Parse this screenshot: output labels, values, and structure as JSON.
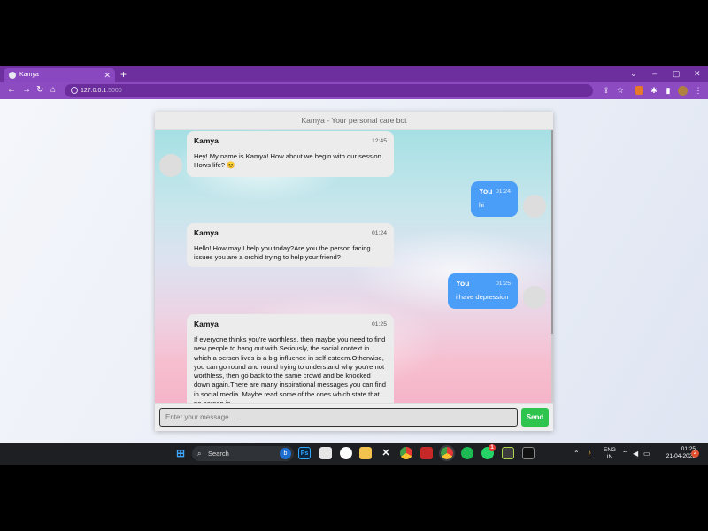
{
  "browser": {
    "tab_title": "Kamya",
    "tab_close": "✕",
    "new_tab": "+",
    "url_host": "127.0.0.1",
    "url_port": ":5000",
    "controls": {
      "collapse": "⌄",
      "minimize": "–",
      "maximize": "▢",
      "close": "✕"
    },
    "nav": {
      "back": "←",
      "forward": "→",
      "reload": "↻",
      "home": "⌂"
    }
  },
  "chat": {
    "header": "Kamya - Your personal care bot",
    "messages": [
      {
        "sender": "Kamya",
        "time": "12:45",
        "text": "Hey! My name is Kamya! How about we begin with our session. Hows life? 😊"
      },
      {
        "sender": "You",
        "time": "01:24",
        "text": "hi"
      },
      {
        "sender": "Kamya",
        "time": "01:24",
        "text": "Hello! How may I help you today?Are you the person facing issues you are a orchid trying to help your friend?"
      },
      {
        "sender": "You",
        "time": "01:25",
        "text": "i have depression"
      },
      {
        "sender": "Kamya",
        "time": "01:25",
        "text": "If everyone thinks you're worthless, then maybe you need to find new people to hang out with.Seriously, the social context in which a person lives is a big influence in self-esteem.Otherwise, you can go round and round trying to understand why you're not worthless, then go back to the same crowd and be knocked down again.There are many inspirational messages you can find in social media. Maybe read some of the ones which state that no person is"
      }
    ],
    "input_placeholder": "Enter your message...",
    "send_label": "Send"
  },
  "taskbar": {
    "search_label": "Search",
    "bing_label": "b",
    "ps_label": "Ps",
    "whatsapp_badge": "1",
    "language": "ENG",
    "region": "IN",
    "time": "01:25",
    "date": "21-04-2023",
    "notification_count": "2"
  }
}
